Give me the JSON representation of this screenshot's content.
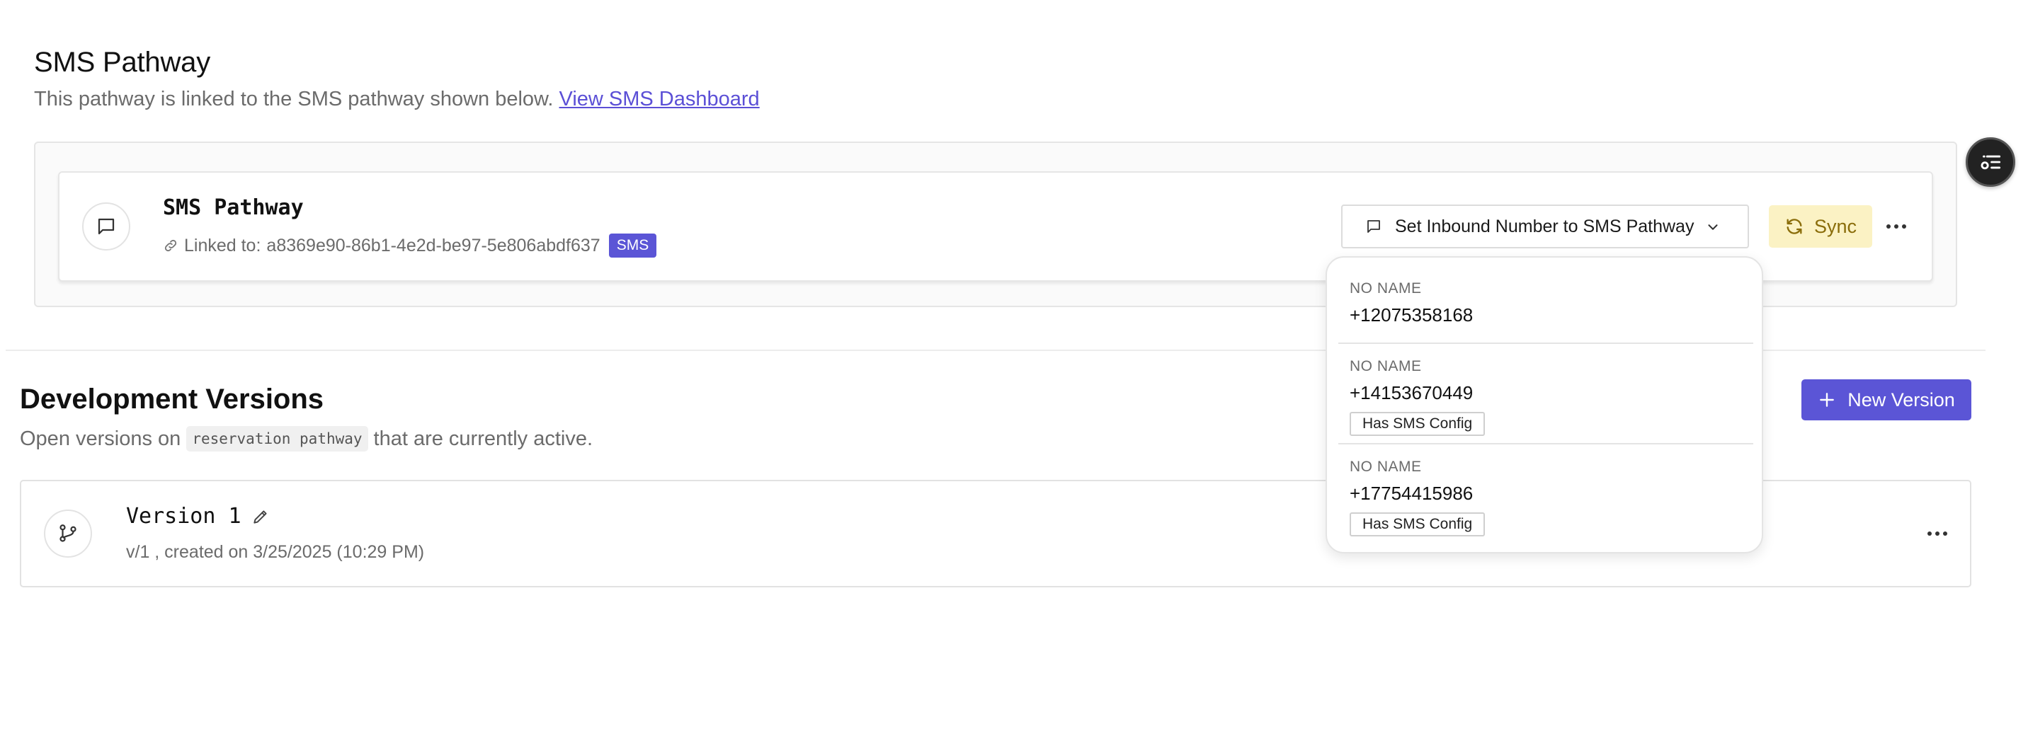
{
  "sms_section": {
    "title": "SMS Pathway",
    "description": "This pathway is linked to the SMS pathway shown below.",
    "dashboard_link": "View SMS Dashboard"
  },
  "sms_card": {
    "title": "SMS Pathway",
    "linked_prefix": "Linked to:",
    "linked_id": "a8369e90-86b1-4e2d-be97-5e806abdf637",
    "badge": "SMS",
    "inbound_button": "Set Inbound Number to SMS Pathway",
    "sync_button": "Sync"
  },
  "dropdown": {
    "items": [
      {
        "name": "NO NAME",
        "number": "+12075358168",
        "tag": ""
      },
      {
        "name": "NO NAME",
        "number": "+14153670449",
        "tag": "Has SMS Config"
      },
      {
        "name": "NO NAME",
        "number": "+17754415986",
        "tag": "Has SMS Config"
      }
    ]
  },
  "dev_section": {
    "title": "Development Versions",
    "desc_before": "Open versions on",
    "pathway_code": "reservation pathway",
    "desc_after": "that are currently active.",
    "new_version_button": "New Version"
  },
  "version_card": {
    "title": "Version 1",
    "meta": "v/1 , created on 3/25/2025 (10:29 PM)"
  },
  "colors": {
    "accent": "#5b55d6",
    "sync_bg": "#fbf2c4",
    "sync_text": "#8a6d0a",
    "link": "#5b4fd6"
  }
}
